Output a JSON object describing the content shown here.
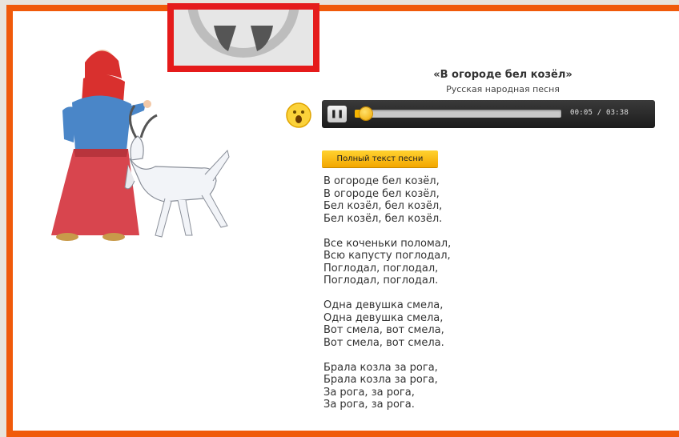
{
  "song": {
    "title": "«В огороде бел козёл»",
    "subtitle": "Русская народная песня"
  },
  "player": {
    "time": "00:05 / 03:38",
    "progress": 0.023,
    "state": "playing"
  },
  "lyrics_button": "Полный текст песни",
  "lyrics": [
    {
      "lines": [
        "В огороде бел козёл,",
        "В огороде бел козёл,",
        "Бел козёл, бел козёл,",
        "Бел козёл, бел козёл."
      ]
    },
    {
      "lines": [
        "Все коченьки поломал,",
        "Всю капусту поглодал,",
        "Поглодал, поглодал,",
        "Поглодал, поглодал."
      ]
    },
    {
      "lines": [
        "Одна девушка смела,",
        "Одна девушка смела,",
        "Вот смела, вот смела,",
        "Вот смела, вот смела."
      ]
    },
    {
      "lines": [
        "Брала козла за рога,",
        "Брала козла за рога,",
        "За рога, за рога,",
        "За рога, за рога."
      ]
    }
  ],
  "colors": {
    "frame": "#f05a0a",
    "logo_border": "#e51b1b",
    "accent": "#f6b400"
  },
  "icons": {
    "logo": "wordpress-logo-icon",
    "sing": "singing-face-icon",
    "pause": "pause-icon"
  }
}
